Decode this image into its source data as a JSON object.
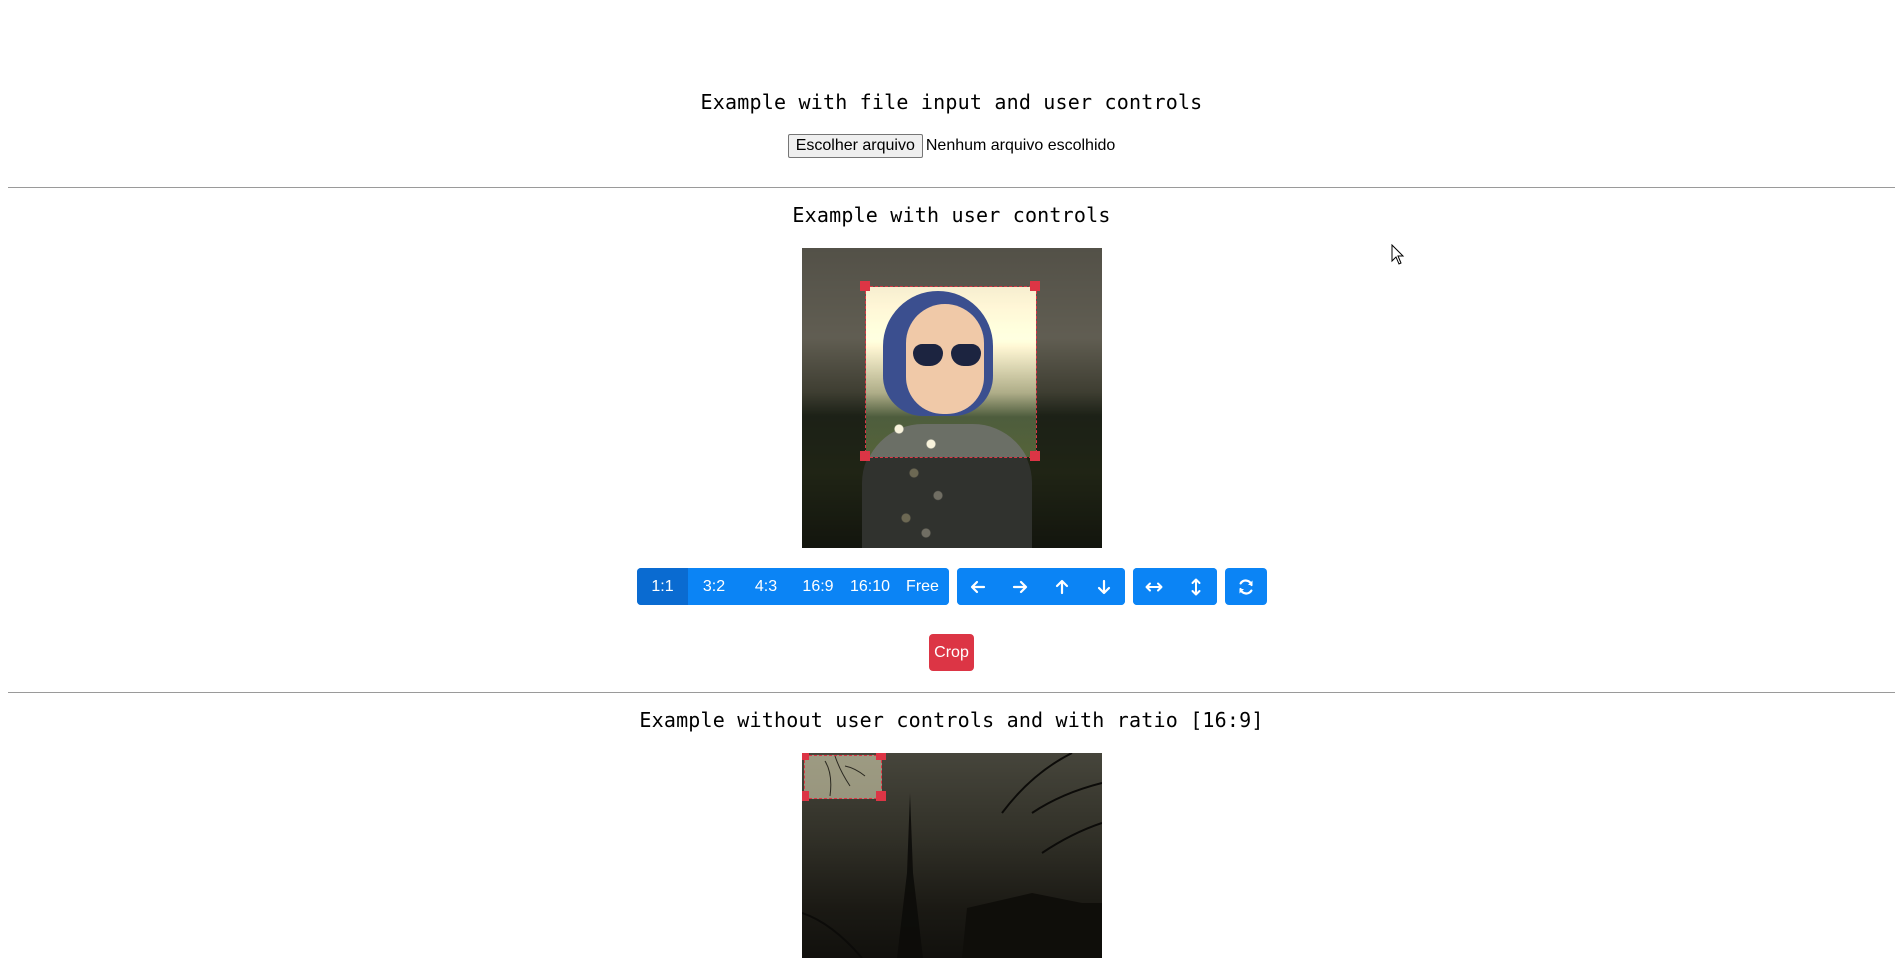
{
  "sections": {
    "file_example": {
      "title": "Example with file input and user controls",
      "file_button_label": "Escolher arquivo",
      "file_status": "Nenhum arquivo escolhido"
    },
    "controls_example": {
      "title": "Example with user controls",
      "aspect_ratios": [
        "1:1",
        "3:2",
        "4:3",
        "16:9",
        "16:10",
        "Free"
      ],
      "selected_ratio": "1:1",
      "move_icons": [
        "arrow-left-icon",
        "arrow-right-icon",
        "arrow-up-icon",
        "arrow-down-icon"
      ],
      "flip_icons": [
        "flip-horizontal-icon",
        "flip-vertical-icon"
      ],
      "reset_icon": "refresh-icon",
      "crop_label": "Crop"
    },
    "ratio_example": {
      "title": "Example without user controls and with ratio [16:9]"
    }
  },
  "colors": {
    "primary": "#0b84f5",
    "primary_active": "#0a6bd1",
    "danger": "#dc3545"
  }
}
